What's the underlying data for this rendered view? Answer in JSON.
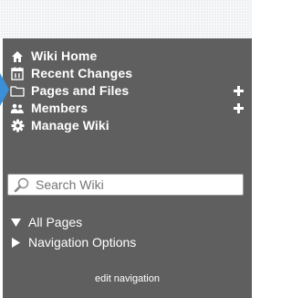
{
  "nav": {
    "items": [
      {
        "label": "Wiki Home",
        "icon": "house-icon"
      },
      {
        "label": "Recent Changes",
        "icon": "calendar-icon"
      },
      {
        "label": "Pages and Files",
        "icon": "folder-icon",
        "action_icon": "plus-icon"
      },
      {
        "label": "Members",
        "icon": "members-icon",
        "action_icon": "plus-icon"
      },
      {
        "label": "Manage Wiki",
        "icon": "gear-icon"
      }
    ]
  },
  "search": {
    "placeholder": "Search Wiki",
    "icon": "magnifier-icon"
  },
  "tree": {
    "all_pages": "All Pages",
    "navigation_options": "Navigation Options"
  },
  "footer": {
    "edit_navigation": "edit navigation"
  },
  "colors": {
    "sidebar_bg": "#5f5f5f",
    "text": "#ffffff",
    "pointer": "#3b8fd6"
  }
}
